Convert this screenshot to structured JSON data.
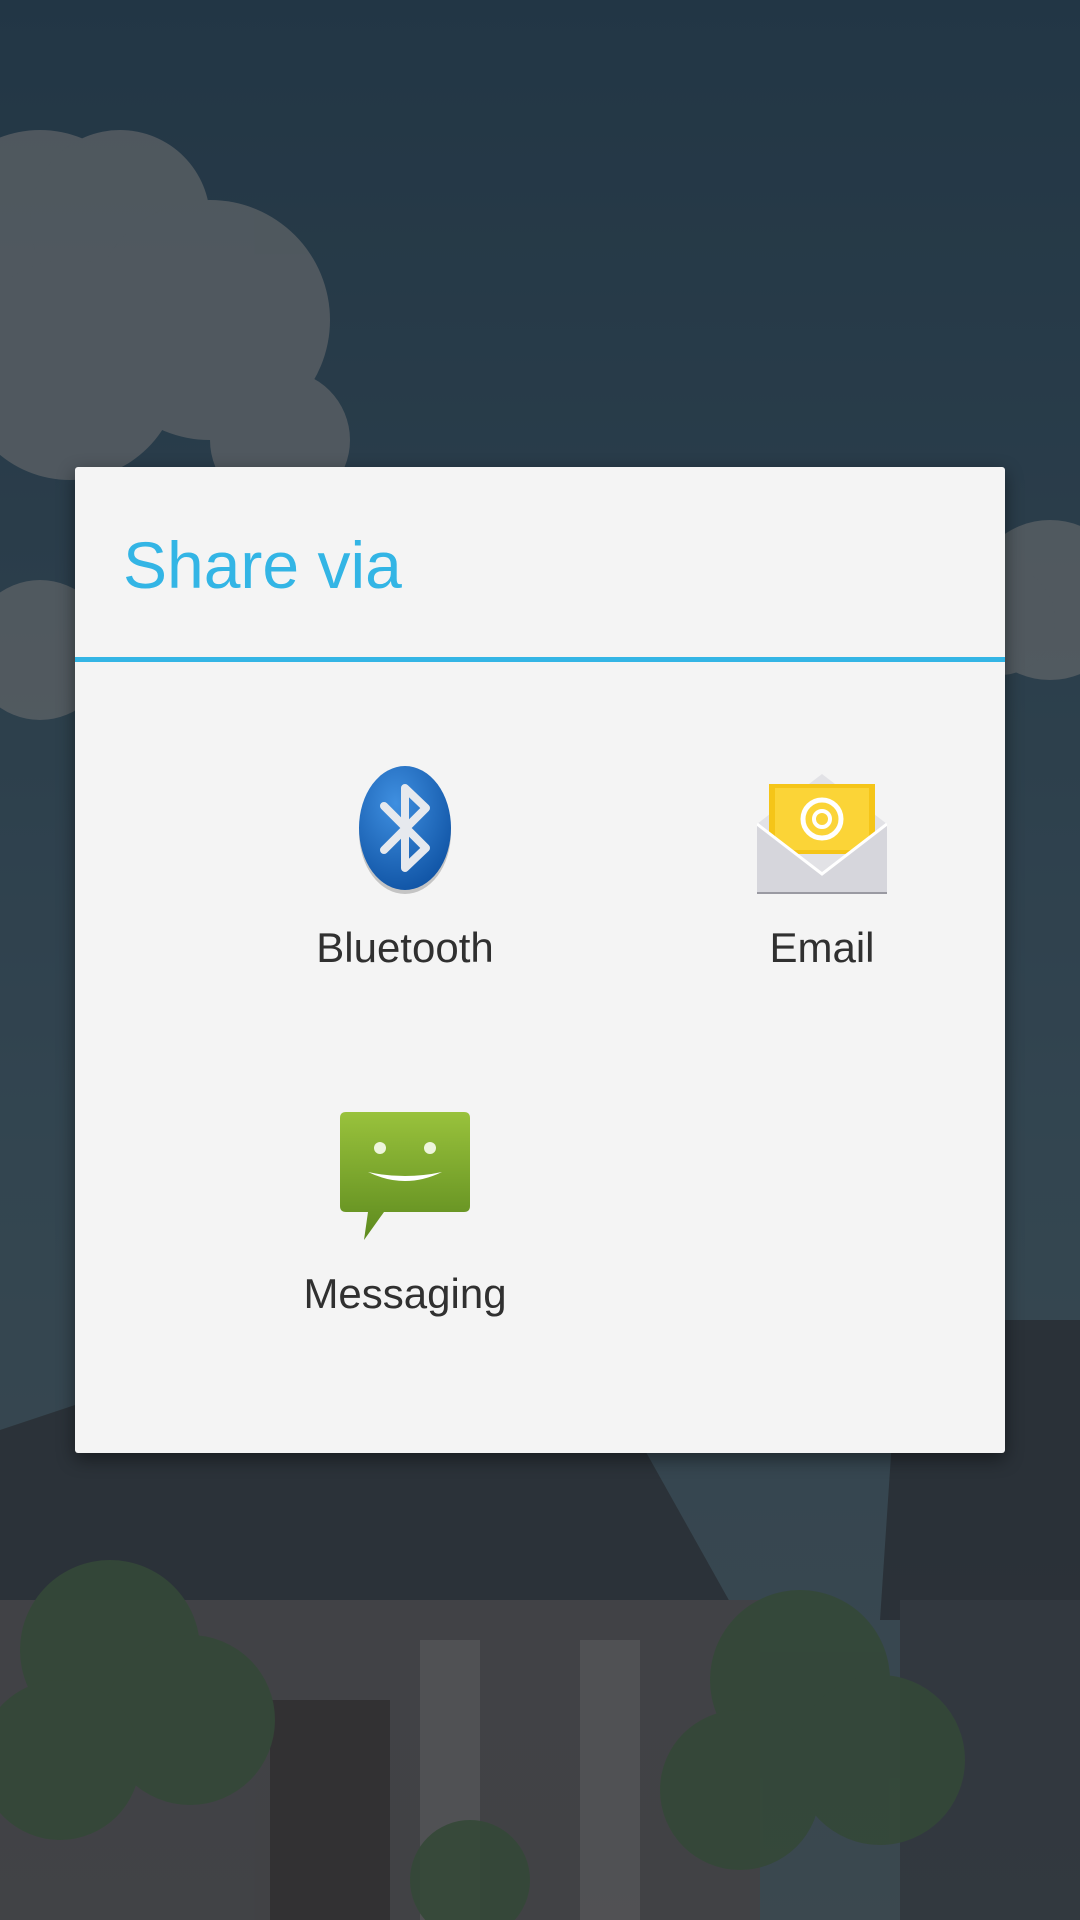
{
  "dialog": {
    "title": "Share via",
    "accent_color": "#33b5e5",
    "items": [
      {
        "label": "Bluetooth",
        "icon": "bluetooth-icon"
      },
      {
        "label": "Email",
        "icon": "email-icon"
      },
      {
        "label": "Messaging",
        "icon": "messaging-icon"
      }
    ]
  }
}
